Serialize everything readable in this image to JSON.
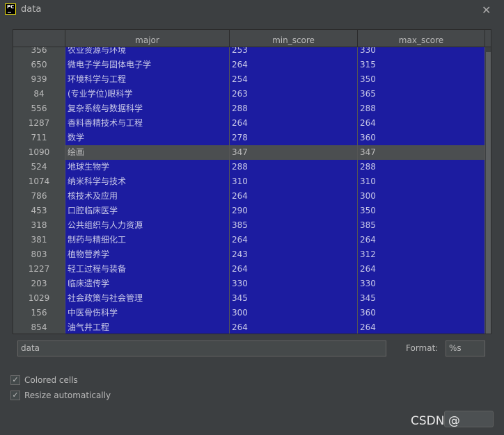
{
  "window": {
    "title": "data",
    "close_icon": "close-icon",
    "app_icon": "pycharm-icon",
    "app_icon_text": "PC"
  },
  "table": {
    "columns": [
      "major",
      "min_score",
      "max_score"
    ],
    "selected_index": "1090",
    "cell_color": "#1c1ca0",
    "rows": [
      {
        "index": "356",
        "major": "农业资源与环境",
        "min_score": "253",
        "max_score": "330"
      },
      {
        "index": "650",
        "major": "微电子学与固体电子学",
        "min_score": "264",
        "max_score": "315"
      },
      {
        "index": "939",
        "major": "环境科学与工程",
        "min_score": "254",
        "max_score": "350"
      },
      {
        "index": "84",
        "major": "(专业学位)眼科学",
        "min_score": "263",
        "max_score": "365"
      },
      {
        "index": "556",
        "major": "复杂系统与数据科学",
        "min_score": "288",
        "max_score": "288"
      },
      {
        "index": "1287",
        "major": "香料香精技术与工程",
        "min_score": "264",
        "max_score": "264"
      },
      {
        "index": "711",
        "major": "数学",
        "min_score": "278",
        "max_score": "360"
      },
      {
        "index": "1090",
        "major": "绘画",
        "min_score": "347",
        "max_score": "347"
      },
      {
        "index": "524",
        "major": "地球生物学",
        "min_score": "288",
        "max_score": "288"
      },
      {
        "index": "1074",
        "major": "纳米科学与技术",
        "min_score": "310",
        "max_score": "310"
      },
      {
        "index": "786",
        "major": "核技术及应用",
        "min_score": "264",
        "max_score": "300"
      },
      {
        "index": "453",
        "major": "口腔临床医学",
        "min_score": "290",
        "max_score": "350"
      },
      {
        "index": "318",
        "major": "公共组织与人力资源",
        "min_score": "385",
        "max_score": "385"
      },
      {
        "index": "381",
        "major": "制药与精细化工",
        "min_score": "264",
        "max_score": "264"
      },
      {
        "index": "803",
        "major": "植物营养学",
        "min_score": "243",
        "max_score": "312"
      },
      {
        "index": "1227",
        "major": "轻工过程与装备",
        "min_score": "264",
        "max_score": "264"
      },
      {
        "index": "203",
        "major": "临床遗传学",
        "min_score": "330",
        "max_score": "330"
      },
      {
        "index": "1029",
        "major": "社会政策与社会管理",
        "min_score": "345",
        "max_score": "345"
      },
      {
        "index": "156",
        "major": "中医骨伤科学",
        "min_score": "300",
        "max_score": "360"
      },
      {
        "index": "854",
        "major": "油气井工程",
        "min_score": "264",
        "max_score": "264"
      }
    ]
  },
  "expression": {
    "value": "data"
  },
  "format": {
    "label": "Format:",
    "value": "%s"
  },
  "options": {
    "colored_cells": {
      "label": "Colored cells",
      "checked": true
    },
    "resize_automatically": {
      "label": "Resize automatically",
      "checked": true
    }
  },
  "watermark": "CSDN @"
}
